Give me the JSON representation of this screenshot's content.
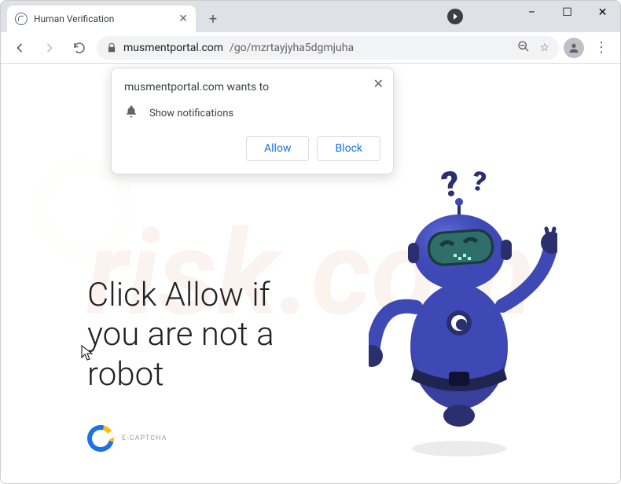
{
  "window": {
    "tab_title": "Human Verification",
    "minimize": "–",
    "maximize": "☐",
    "close": "✕"
  },
  "toolbar": {
    "back": "←",
    "forward": "→",
    "reload": "⟳",
    "url_domain": "musmentportal.com",
    "url_path": "/go/mzrtayjyha5dgmjuha",
    "zoom_icon": "⊖",
    "star": "☆",
    "menu": "⋮"
  },
  "prompt": {
    "origin_text": "musmentportal.com wants to",
    "permission_label": "Show notifications",
    "allow_label": "Allow",
    "block_label": "Block",
    "close": "✕"
  },
  "page": {
    "headline_line1": "Click Allow if",
    "headline_line2": "you are not a",
    "headline_line3": "robot",
    "captcha_label": "E-CAPTCHA",
    "question_marks": "??"
  },
  "watermark": {
    "text": "risk.com"
  },
  "colors": {
    "robot_primary": "#3f49b5",
    "robot_dark": "#2a2f6e",
    "accent_blue": "#1a73e8"
  }
}
